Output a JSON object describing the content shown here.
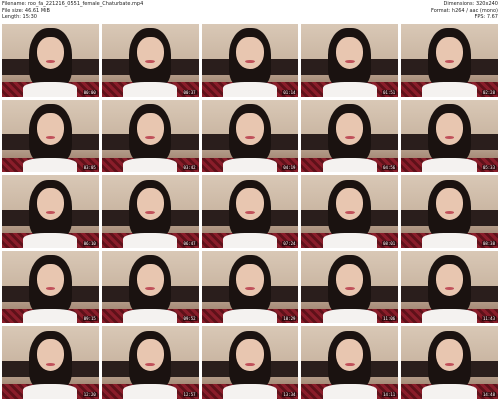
{
  "header": {
    "filename": "Filename: roo_fa_221216_0551_female_Chaturbate.mp4",
    "filesize": "File size: 46.61 MiB",
    "length": "Length: 15:30",
    "dimensions": "Dimensions: 320x240",
    "format": "Format: h264 / aac (mono)",
    "fps": "FPS: 7.67"
  },
  "thumbnails": [
    {
      "stamp": "00:00"
    },
    {
      "stamp": "00:37"
    },
    {
      "stamp": "01:14"
    },
    {
      "stamp": "01:51"
    },
    {
      "stamp": "02:28"
    },
    {
      "stamp": "03:05"
    },
    {
      "stamp": "03:42"
    },
    {
      "stamp": "04:19"
    },
    {
      "stamp": "04:56"
    },
    {
      "stamp": "05:33"
    },
    {
      "stamp": "06:10"
    },
    {
      "stamp": "06:47"
    },
    {
      "stamp": "07:24"
    },
    {
      "stamp": "08:01"
    },
    {
      "stamp": "08:38"
    },
    {
      "stamp": "09:15"
    },
    {
      "stamp": "09:52"
    },
    {
      "stamp": "10:29"
    },
    {
      "stamp": "11:06"
    },
    {
      "stamp": "11:43"
    },
    {
      "stamp": "12:20"
    },
    {
      "stamp": "12:57"
    },
    {
      "stamp": "13:34"
    },
    {
      "stamp": "14:11"
    },
    {
      "stamp": "14:48"
    }
  ]
}
